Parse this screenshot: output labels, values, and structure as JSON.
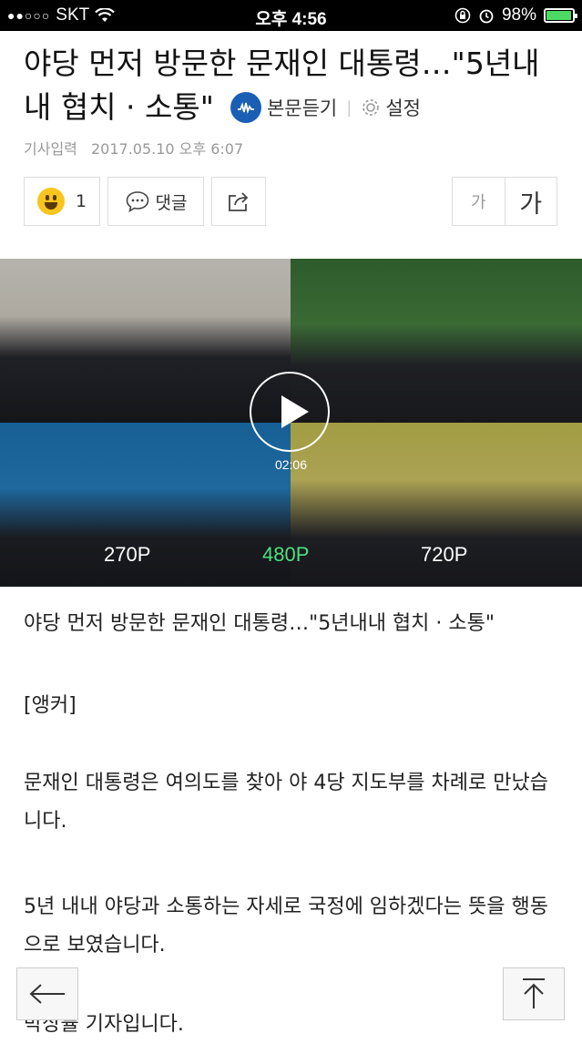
{
  "status_bar": {
    "carrier": "SKT",
    "time": "오후 4:56",
    "battery_text": "98%",
    "battery_level": 0.98,
    "battery_color": "#4cd964",
    "signal_icon": "signal-dots-icon",
    "wifi_icon": "wifi-icon",
    "lock_icon": "rotation-lock-icon",
    "alarm_icon": "alarm-icon"
  },
  "article": {
    "title_line1": "야당 먼저 방문한 문재인 대통령…\"5년내",
    "title_line2": "내 협치 · 소통\"",
    "listen_label": "본문듣기",
    "settings_label": "설정",
    "date_label": "기사입력",
    "date_value": "2017.05.10 오후 6:07"
  },
  "actions": {
    "reaction_count": "1",
    "comment_label": "댓글",
    "font_small": "가",
    "font_large": "가"
  },
  "video": {
    "duration": "02:06",
    "qualities": [
      "270P",
      "480P",
      "720P"
    ],
    "selected_quality": "480P",
    "accent_color": "#4ee07e"
  },
  "body": {
    "paragraphs": [
      "야당 먼저 방문한 문재인 대통령…\"5년내내 협치 · 소통\"",
      "[앵커]",
      "문재인 대통령은 여의도를 찾아 야 4당 지도부를 차례로 만났습니다.",
      "5년 내내 야당과 소통하는 자세로 국정에 임하겠다는 뜻을 행동으로 보였습니다.",
      "박상률 기자입니다."
    ]
  },
  "nav": {
    "back_icon": "back-arrow-icon",
    "top_icon": "scroll-top-icon"
  }
}
